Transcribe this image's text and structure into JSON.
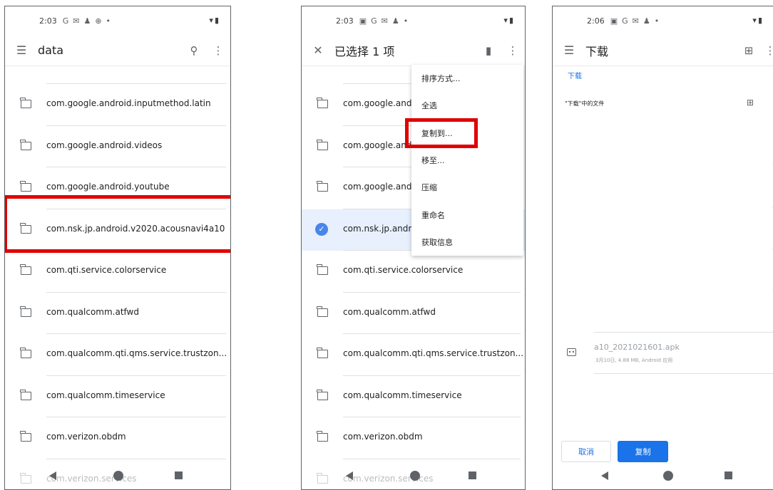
{
  "screen1": {
    "status": {
      "time": "2:03",
      "icons": [
        "G",
        "✉",
        "♟",
        "⊕",
        "•"
      ],
      "right": "▾▮"
    },
    "appbar": {
      "title": "data"
    },
    "rows": [
      {
        "name": ""
      },
      {
        "name": "com.google.android.inputmethod.latin"
      },
      {
        "name": "com.google.android.videos"
      },
      {
        "name": "com.google.android.youtube"
      },
      {
        "name": "com.nsk.jp.android.v2020.acousnavi4a10"
      },
      {
        "name": "com.qti.service.colorservice"
      },
      {
        "name": "com.qualcomm.atfwd"
      },
      {
        "name": "com.qualcomm.qti.qms.service.trustzon..."
      },
      {
        "name": "com.qualcomm.timeservice"
      },
      {
        "name": "com.verizon.obdm"
      },
      {
        "name": "com.verizon.services"
      }
    ]
  },
  "screen2": {
    "status": {
      "time": "2:03",
      "icons": [
        "▣",
        "G",
        "✉",
        "♟",
        "•"
      ],
      "right": "▾▮"
    },
    "appbar": {
      "title": "已选择 1 项"
    },
    "rows": [
      {
        "name": ""
      },
      {
        "name": "com.google.andr"
      },
      {
        "name": "com.google.and"
      },
      {
        "name": "com.google.andr"
      },
      {
        "name": "com.nsk.jp.andro"
      },
      {
        "name": "com.qti.service.colorservice"
      },
      {
        "name": "com.qualcomm.atfwd"
      },
      {
        "name": "com.qualcomm.qti.qms.service.trustzon..."
      },
      {
        "name": "com.qualcomm.timeservice"
      },
      {
        "name": "com.verizon.obdm"
      },
      {
        "name": "com.verizon.services"
      }
    ],
    "menu": [
      "排序方式...",
      "全选",
      "复制到...",
      "移至...",
      "压缩",
      "重命名",
      "获取信息"
    ]
  },
  "screen3": {
    "status": {
      "time": "2:06",
      "icons": [
        "▣",
        "G",
        "✉",
        "♟",
        "•"
      ],
      "right": "▾▮"
    },
    "appbar": {
      "title": "下载"
    },
    "breadcrumb": "下载",
    "section_label": "\"下载\"中的文件",
    "file": {
      "name": "a10_2021021601.apk",
      "meta": "3月10日, 4.88 MB, Android 应用"
    },
    "cancel_label": "取消",
    "copy_label": "复制",
    "accent": "#1a73e8"
  }
}
